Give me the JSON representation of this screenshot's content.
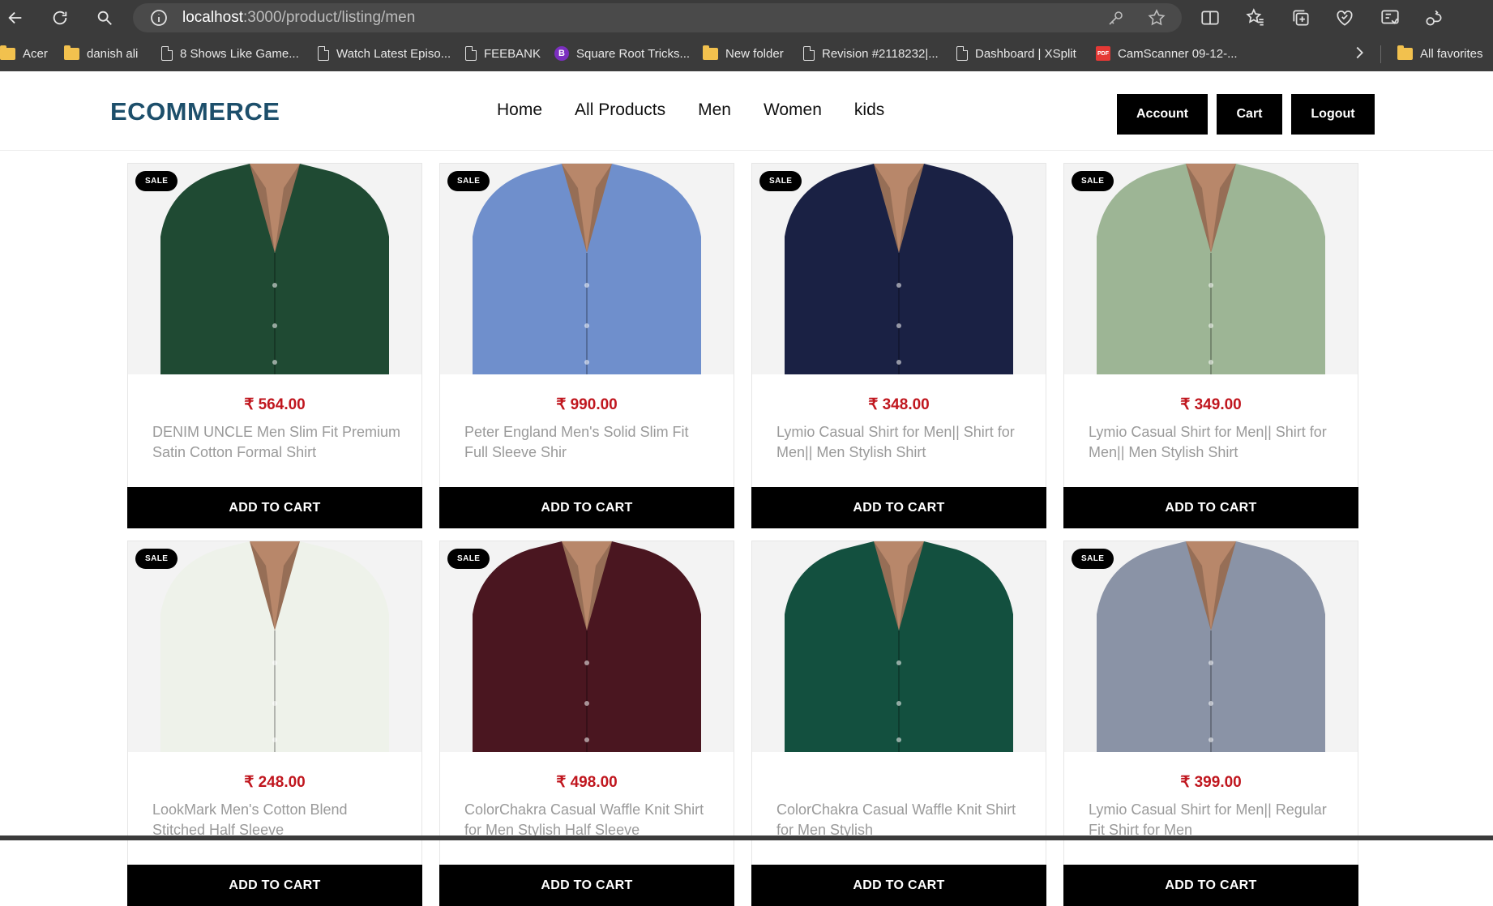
{
  "browser": {
    "url_host": "localhost",
    "url_path": ":3000/product/listing/men",
    "bookmarks": [
      {
        "label": "Acer",
        "icon": "folder-icon"
      },
      {
        "label": "danish ali",
        "icon": "folder-icon"
      },
      {
        "label": "8 Shows Like Game...",
        "icon": "page-icon"
      },
      {
        "label": "Watch Latest Episo...",
        "icon": "page-icon"
      },
      {
        "label": "FEEBANK",
        "icon": "page-icon"
      },
      {
        "label": "Square Root Tricks...",
        "icon": "purple-logo-icon"
      },
      {
        "label": "New folder",
        "icon": "folder-icon"
      },
      {
        "label": "Revision #2118232|...",
        "icon": "page-icon"
      },
      {
        "label": "Dashboard | XSplit",
        "icon": "page-icon"
      },
      {
        "label": "CamScanner 09-12-...",
        "icon": "pdf-icon"
      }
    ],
    "all_favorites": "All favorites"
  },
  "site": {
    "logo": "ECOMMERCE",
    "menu": [
      "Home",
      "All Products",
      "Men",
      "Women",
      "kids"
    ],
    "buttons": {
      "account": "Account",
      "cart": "Cart",
      "logout": "Logout"
    }
  },
  "products": [
    {
      "badge": "SALE",
      "price": "₹ 564.00",
      "name": "DENIM UNCLE Men Slim Fit Premium Satin Cotton Formal Shirt",
      "cta": "ADD TO CART",
      "color": "#1f4a33"
    },
    {
      "badge": "SALE",
      "price": "₹ 990.00",
      "name": "Peter England Men's Solid Slim Fit Full Sleeve Shir",
      "cta": "ADD TO CART",
      "color": "#6f8fcc"
    },
    {
      "badge": "SALE",
      "price": "₹ 348.00",
      "name": "Lymio Casual Shirt for Men|| Shirt for Men|| Men Stylish Shirt",
      "cta": "ADD TO CART",
      "color": "#1a2144"
    },
    {
      "badge": "SALE",
      "price": "₹ 349.00",
      "name": "Lymio Casual Shirt for Men|| Shirt for Men|| Men Stylish Shirt",
      "cta": "ADD TO CART",
      "color": "#9db595"
    },
    {
      "badge": "SALE",
      "price": "₹ 248.00",
      "name": "LookMark Men's Cotton Blend Stitched Half Sleeve",
      "cta": "ADD TO CART",
      "color": "#eef2ea"
    },
    {
      "badge": "SALE",
      "price": "₹ 498.00",
      "name": "ColorChakra Casual Waffle Knit Shirt for Men Stylish Half Sleeve",
      "cta": "ADD TO CART",
      "color": "#4a1620"
    },
    {
      "badge": "",
      "price": "",
      "name": "ColorChakra Casual Waffle Knit Shirt for Men Stylish",
      "cta": "ADD TO CART",
      "color": "#13503f"
    },
    {
      "badge": "SALE",
      "price": "₹ 399.00",
      "name": "Lymio Casual Shirt for Men|| Regular Fit Shirt for Men",
      "cta": "ADD TO CART",
      "color": "#8a93a6"
    }
  ]
}
